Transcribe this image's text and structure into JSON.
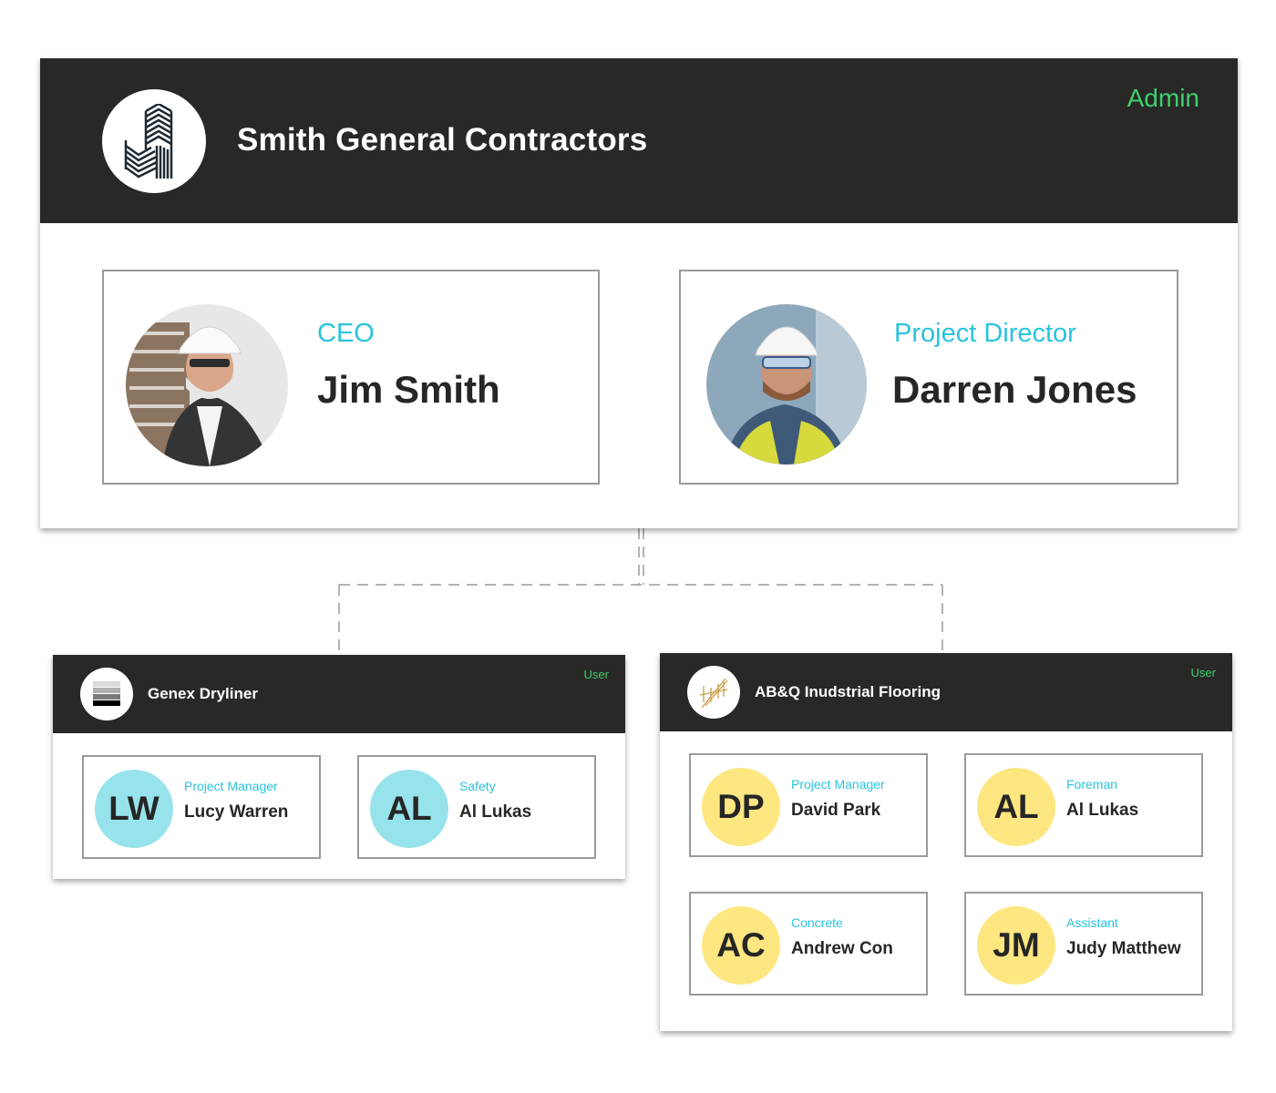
{
  "colors": {
    "header_bg": "#282827",
    "role_accent": "#3fcf6e",
    "title_accent": "#29c3dc",
    "avatar_cyan": "#97e3ec",
    "avatar_yellow": "#fee681",
    "border": "#9a9a9a"
  },
  "company": {
    "name": "Smith General Contractors",
    "role": "Admin",
    "logo_icon": "building-logo-icon",
    "executives": [
      {
        "title": "CEO",
        "name": "Jim Smith",
        "photo": "photo-icon"
      },
      {
        "title": "Project Director",
        "name": "Darren Jones",
        "photo": "photo-icon"
      }
    ]
  },
  "subcontractors": [
    {
      "name": "Genex Dryliner",
      "role": "User",
      "logo_icon": "stacked-layers-logo-icon",
      "members": [
        {
          "initials": "LW",
          "title": "Project Manager",
          "name": "Lucy Warren"
        },
        {
          "initials": "AL",
          "title": "Safety",
          "name": "Al Lukas"
        }
      ]
    },
    {
      "name": "AB&Q Inudstrial Flooring",
      "role": "User",
      "logo_icon": "gold-lines-logo-icon",
      "members": [
        {
          "initials": "DP",
          "title": "Project Manager",
          "name": "David Park"
        },
        {
          "initials": "AL",
          "title": "Foreman",
          "name": "Al Lukas"
        },
        {
          "initials": "AC",
          "title": "Concrete",
          "name": "Andrew Con"
        },
        {
          "initials": "JM",
          "title": "Assistant",
          "name": "Judy Matthew"
        }
      ]
    }
  ]
}
